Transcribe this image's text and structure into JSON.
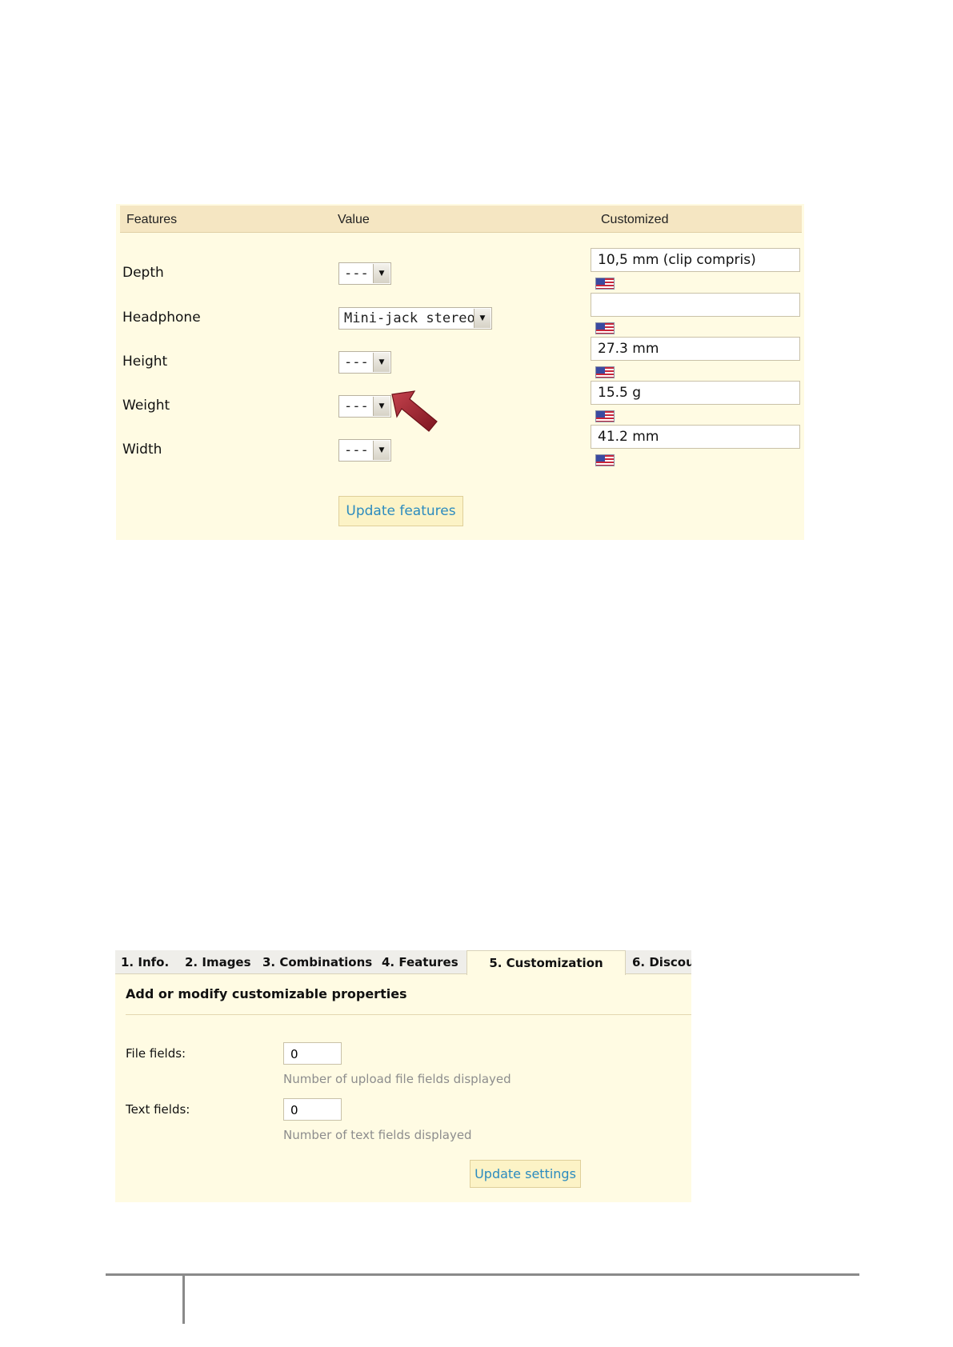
{
  "features": {
    "headers": {
      "features": "Features",
      "value": "Value",
      "customized": "Customized"
    },
    "rows": [
      {
        "label": "Depth",
        "select": "---",
        "custom": "10,5 mm (clip compris)"
      },
      {
        "label": "Headphone",
        "select": "Mini-jack stereo",
        "custom": ""
      },
      {
        "label": "Height",
        "select": "---",
        "custom": "27.3 mm"
      },
      {
        "label": "Weight",
        "select": "---",
        "custom": "15.5 g"
      },
      {
        "label": "Width",
        "select": "---",
        "custom": "41.2 mm"
      }
    ],
    "update_button": "Update features",
    "arrow_glyph": "▼",
    "flag_icon": "us-flag-icon",
    "colors": {
      "panel_bg": "#fffbe3",
      "header_bg": "#f5e6c2",
      "button_text": "#2b8bbf",
      "pointer_arrow": "#a3232f"
    }
  },
  "customization": {
    "tabs": [
      {
        "label": "1. Info."
      },
      {
        "label": "2. Images"
      },
      {
        "label": "3. Combinations"
      },
      {
        "label": "4. Features"
      },
      {
        "label": "5. Customization",
        "active": true
      },
      {
        "label": "6. Discou"
      }
    ],
    "title": "Add or modify customizable properties",
    "file_fields": {
      "label": "File fields:",
      "value": "0",
      "hint": "Number of upload file fields displayed"
    },
    "text_fields": {
      "label": "Text fields:",
      "value": "0",
      "hint": "Number of text fields displayed"
    },
    "update_button": "Update settings"
  }
}
